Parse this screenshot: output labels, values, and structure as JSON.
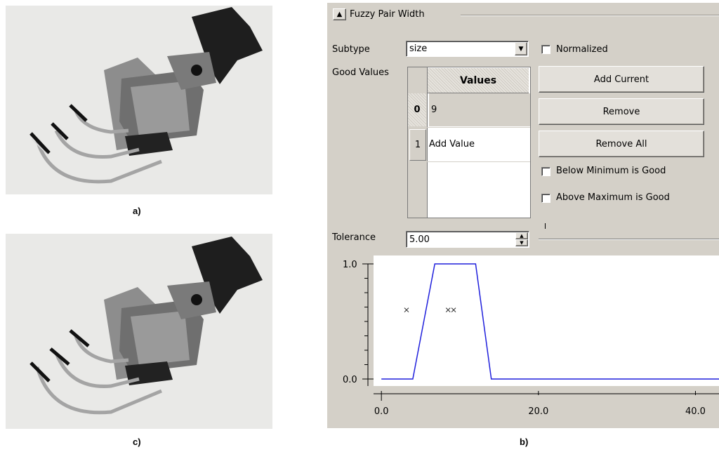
{
  "captions": {
    "a": "a)",
    "b": "b)",
    "c": "c)"
  },
  "panel": {
    "group_title": "Fuzzy Pair Width",
    "collapse_icon": "chevron-up-icon",
    "subtype_label": "Subtype",
    "subtype_value": "size",
    "normalized_label": "Normalized",
    "good_values_label": "Good Values",
    "table": {
      "header": "Values",
      "rows": [
        {
          "index": "0",
          "value": "9"
        },
        {
          "index": "1",
          "value": "Add Value"
        }
      ]
    },
    "buttons": {
      "add_current": "Add Current",
      "remove": "Remove",
      "remove_all": "Remove All"
    },
    "below_min_label": "Below Minimum is Good",
    "above_max_label": "Above Maximum is Good",
    "tolerance_label": "Tolerance",
    "tolerance_value": "5.00"
  },
  "chart_data": {
    "type": "line",
    "x": [
      0,
      4,
      6.8,
      12,
      14,
      43
    ],
    "y": [
      0,
      0,
      1,
      1,
      0,
      0
    ],
    "markers": [
      {
        "x": 3.2,
        "y": 0.6
      },
      {
        "x": 8.5,
        "y": 0.6
      },
      {
        "x": 9.2,
        "y": 0.6
      }
    ],
    "xlim": [
      -1,
      43
    ],
    "ylim": [
      0,
      1
    ],
    "x_ticks": [
      "0.0",
      "20.0",
      "40.0"
    ],
    "y_ticks": [
      "0.0",
      "1.0"
    ],
    "line_color": "#1f1fdc"
  }
}
